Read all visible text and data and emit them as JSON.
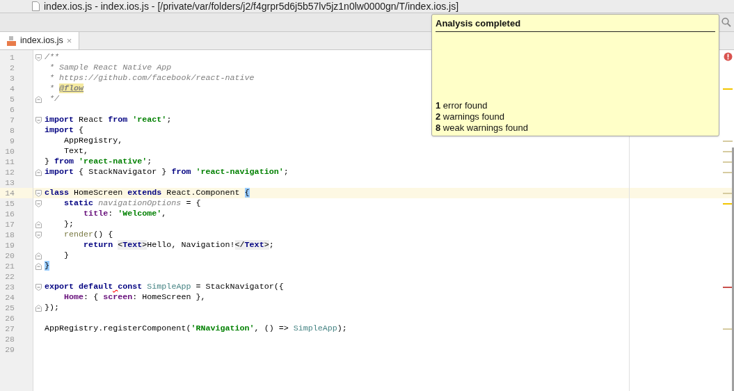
{
  "window": {
    "title": "index.ios.js - index.ios.js - [/private/var/folders/j2/f4grpr5d6j5b57lv5jz1n0lw0000gn/T/index.ios.js]"
  },
  "tabs": [
    {
      "label": "index.ios.js",
      "close": "×",
      "selected": true
    }
  ],
  "editor": {
    "lines": [
      {
        "number": "1",
        "current": false,
        "fold": {
          "kind": "start"
        },
        "tokens": [
          {
            "text": "/**",
            "kind": "comment"
          }
        ]
      },
      {
        "number": "2",
        "current": false,
        "tokens": [
          {
            "text": " * Sample React Native App",
            "kind": "comment"
          }
        ]
      },
      {
        "number": "3",
        "current": false,
        "tokens": [
          {
            "text": " * https://github.com/facebook/react-native",
            "kind": "comment"
          }
        ]
      },
      {
        "number": "4",
        "current": false,
        "marker": {
          "kind": "warning"
        },
        "tokens": [
          {
            "text": " * ",
            "kind": "comment"
          },
          {
            "text": "@flow",
            "kind": "doctag"
          }
        ]
      },
      {
        "number": "5",
        "current": false,
        "fold": {
          "kind": "end"
        },
        "tokens": [
          {
            "text": " */",
            "kind": "comment"
          }
        ]
      },
      {
        "number": "6",
        "current": false
      },
      {
        "number": "7",
        "current": false,
        "fold": {
          "kind": "start"
        },
        "tokens": [
          {
            "text": "import",
            "kind": "keyword"
          },
          {
            "text": " React ",
            "kind": "plain"
          },
          {
            "text": "from",
            "kind": "keyword"
          },
          {
            "text": " 'react'",
            "kind": "string"
          },
          {
            "text": ";",
            "kind": "plain"
          }
        ]
      },
      {
        "number": "8",
        "current": false,
        "tokens": [
          {
            "text": "import",
            "kind": "keyword"
          },
          {
            "text": " {",
            "kind": "plain"
          }
        ]
      },
      {
        "number": "9",
        "current": false,
        "marker": {
          "kind": "weak"
        },
        "tokens": [
          {
            "text": "    AppRegistry,",
            "kind": "plain"
          }
        ]
      },
      {
        "number": "10",
        "current": false,
        "marker": {
          "kind": "weak"
        },
        "tokens": [
          {
            "text": "    Text,",
            "kind": "plain"
          }
        ]
      },
      {
        "number": "11",
        "current": false,
        "marker": {
          "kind": "weak"
        },
        "tokens": [
          {
            "text": "} ",
            "kind": "plain"
          },
          {
            "text": "from",
            "kind": "keyword"
          },
          {
            "text": " 'react-native'",
            "kind": "string"
          },
          {
            "text": ";",
            "kind": "plain"
          }
        ]
      },
      {
        "number": "12",
        "current": false,
        "fold": {
          "kind": "end"
        },
        "marker": {
          "kind": "weak"
        },
        "tokens": [
          {
            "text": "import",
            "kind": "keyword"
          },
          {
            "text": " { StackNavigator } ",
            "kind": "plain"
          },
          {
            "text": "from",
            "kind": "keyword"
          },
          {
            "text": " 'react-navigation'",
            "kind": "string"
          },
          {
            "text": ";",
            "kind": "plain"
          }
        ]
      },
      {
        "number": "13",
        "current": false
      },
      {
        "number": "14",
        "current": true,
        "fold": {
          "kind": "start"
        },
        "marker": {
          "kind": "weak"
        },
        "tokens": [
          {
            "text": "class",
            "kind": "keyword"
          },
          {
            "text": " HomeScreen ",
            "kind": "plain"
          },
          {
            "text": "extends",
            "kind": "keyword"
          },
          {
            "text": " React.Component ",
            "kind": "plain"
          },
          {
            "text": "{",
            "kind": "brace"
          }
        ]
      },
      {
        "number": "15",
        "current": false,
        "fold": {
          "kind": "start"
        },
        "marker": {
          "kind": "warning"
        },
        "tokens": [
          {
            "text": "    static",
            "kind": "keyword"
          },
          {
            "text": " navigationOptions",
            "kind": "field"
          },
          {
            "text": " = {",
            "kind": "plain"
          }
        ]
      },
      {
        "number": "16",
        "current": false,
        "tokens": [
          {
            "text": "        title",
            "kind": "property"
          },
          {
            "text": ": ",
            "kind": "plain"
          },
          {
            "text": "'Welcome'",
            "kind": "string"
          },
          {
            "text": ",",
            "kind": "plain"
          }
        ]
      },
      {
        "number": "17",
        "current": false,
        "fold": {
          "kind": "end"
        },
        "tokens": [
          {
            "text": "    };",
            "kind": "plain"
          }
        ]
      },
      {
        "number": "18",
        "current": false,
        "fold": {
          "kind": "start"
        },
        "tokens": [
          {
            "text": "    render",
            "kind": "method"
          },
          {
            "text": "() {",
            "kind": "plain"
          }
        ]
      },
      {
        "number": "19",
        "current": false,
        "tokens": [
          {
            "text": "        return",
            "kind": "keyword"
          },
          {
            "text": " <",
            "kind": "tagopen"
          },
          {
            "text": "Text",
            "kind": "tag"
          },
          {
            "text": ">",
            "kind": "tagmark"
          },
          {
            "text": "Hello, Navigation!",
            "kind": "plain"
          },
          {
            "text": "</",
            "kind": "tagmark"
          },
          {
            "text": "Text",
            "kind": "tag"
          },
          {
            "text": ">",
            "kind": "tagmark"
          },
          {
            "text": ";",
            "kind": "plain"
          }
        ]
      },
      {
        "number": "20",
        "current": false,
        "fold": {
          "kind": "end"
        },
        "tokens": [
          {
            "text": "    }",
            "kind": "plain"
          }
        ]
      },
      {
        "number": "21",
        "current": false,
        "fold": {
          "kind": "end"
        },
        "tokens": [
          {
            "text": "}",
            "kind": "brace"
          }
        ]
      },
      {
        "number": "22",
        "current": false
      },
      {
        "number": "23",
        "current": false,
        "fold": {
          "kind": "start"
        },
        "marker": {
          "kind": "error"
        },
        "tokens": [
          {
            "text": "export default",
            "kind": "keyword"
          },
          {
            "text": " const",
            "kind": "squiggled_keyword"
          },
          {
            "text": " SimpleApp",
            "kind": "ident"
          },
          {
            "text": " = StackNavigator({",
            "kind": "plain"
          }
        ]
      },
      {
        "number": "24",
        "current": false,
        "tokens": [
          {
            "text": "    Home",
            "kind": "property"
          },
          {
            "text": ": { ",
            "kind": "plain"
          },
          {
            "text": "screen",
            "kind": "property"
          },
          {
            "text": ": HomeScreen },",
            "kind": "plain"
          }
        ]
      },
      {
        "number": "25",
        "current": false,
        "fold": {
          "kind": "end"
        },
        "tokens": [
          {
            "text": "});",
            "kind": "plain"
          }
        ]
      },
      {
        "number": "26",
        "current": false
      },
      {
        "number": "27",
        "current": false,
        "marker": {
          "kind": "weak"
        },
        "tokens": [
          {
            "text": "AppRegistry.registerComponent(",
            "kind": "plain"
          },
          {
            "text": "'RNavigation'",
            "kind": "string"
          },
          {
            "text": ", () => ",
            "kind": "plain"
          },
          {
            "text": "SimpleApp",
            "kind": "ident"
          },
          {
            "text": ");",
            "kind": "plain"
          }
        ]
      },
      {
        "number": "28",
        "current": false
      },
      {
        "number": "29",
        "current": false
      }
    ]
  },
  "analysis_popup": {
    "title": "Analysis completed",
    "results": [
      "**1** error found",
      "**2** warnings found",
      "**8** weak warnings found"
    ]
  }
}
